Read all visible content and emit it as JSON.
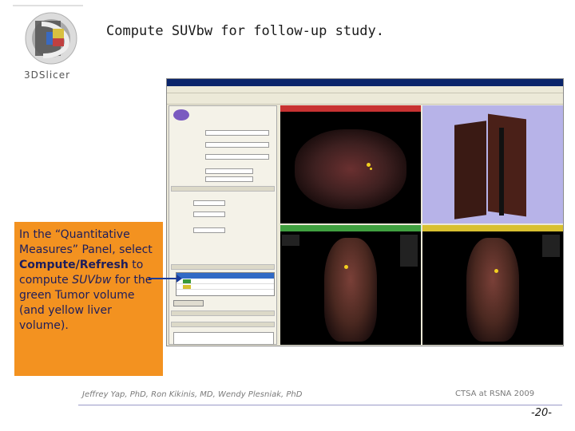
{
  "slide": {
    "title": "Compute SUVbw for follow-up study.",
    "logo_text": "3DSlicer"
  },
  "callout": {
    "part1": "In the “Quantitative Measures” Panel, select ",
    "bold": "Compute/Refresh",
    "part2": " to compute ",
    "italic": "SUVbw",
    "part3": " for the green Tumor volume (and yellow liver volume)."
  },
  "footer": {
    "authors": "Jeffrey Yap, PhD,  Ron Kikinis, MD,  Wendy Plesniak, PhD",
    "conference": "CTSA at RSNA 2009",
    "page_number": "-20-"
  },
  "colors": {
    "callout_bg": "#f39220",
    "arrow": "#1a3c9a",
    "title_bar": "#0a246a",
    "view_3d_bg": "#b7b3e8"
  }
}
